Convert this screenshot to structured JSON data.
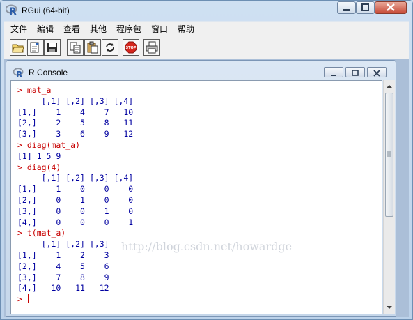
{
  "window": {
    "title": "RGui (64-bit)"
  },
  "menu": [
    "文件",
    "编辑",
    "查看",
    "其他",
    "程序包",
    "窗口",
    "帮助"
  ],
  "toolbar": {
    "buttons": [
      "open-script-icon",
      "load-workspace-icon",
      "save-icon",
      "copy-icon",
      "paste-icon",
      "copy-paste-icon",
      "stop-icon",
      "print-icon"
    ],
    "stop_label": "STOP"
  },
  "console": {
    "title": "R Console",
    "lines": [
      {
        "type": "in",
        "text": "> mat_a"
      },
      {
        "type": "out",
        "text": "     [,1] [,2] [,3] [,4]"
      },
      {
        "type": "out",
        "text": "[1,]    1    4    7   10"
      },
      {
        "type": "out",
        "text": "[2,]    2    5    8   11"
      },
      {
        "type": "out",
        "text": "[3,]    3    6    9   12"
      },
      {
        "type": "in",
        "text": "> diag(mat_a)"
      },
      {
        "type": "out",
        "text": "[1] 1 5 9"
      },
      {
        "type": "in",
        "text": "> diag(4)"
      },
      {
        "type": "out",
        "text": "     [,1] [,2] [,3] [,4]"
      },
      {
        "type": "out",
        "text": "[1,]    1    0    0    0"
      },
      {
        "type": "out",
        "text": "[2,]    0    1    0    0"
      },
      {
        "type": "out",
        "text": "[3,]    0    0    1    0"
      },
      {
        "type": "out",
        "text": "[4,]    0    0    0    1"
      },
      {
        "type": "in",
        "text": "> t(mat_a)"
      },
      {
        "type": "out",
        "text": "     [,1] [,2] [,3]"
      },
      {
        "type": "out",
        "text": "[1,]    1    2    3"
      },
      {
        "type": "out",
        "text": "[2,]    4    5    6"
      },
      {
        "type": "out",
        "text": "[3,]    7    8    9"
      },
      {
        "type": "out",
        "text": "[4,]   10   11   12"
      },
      {
        "type": "in",
        "text": "> "
      }
    ]
  },
  "watermark": "http://blog.csdn.net/howardge",
  "colors": {
    "input": "#c80000",
    "output": "#0000a0"
  }
}
